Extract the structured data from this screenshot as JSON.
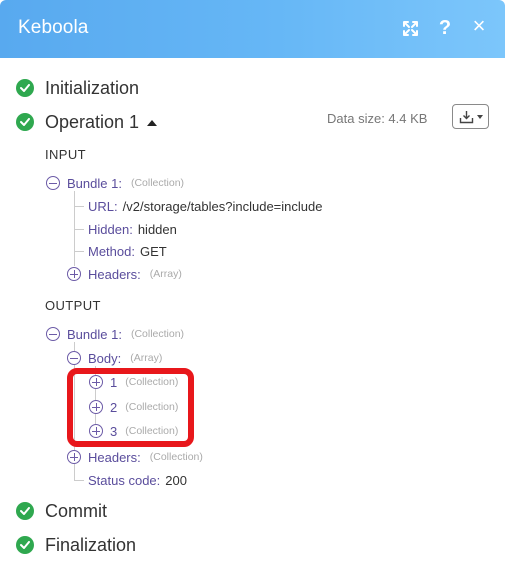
{
  "header": {
    "title": "Keboola",
    "expand_icon": "expand-icon",
    "help_label": "?",
    "close_label": "×"
  },
  "steps": {
    "initialization": "Initialization",
    "operation": "Operation 1",
    "commit": "Commit",
    "finalization": "Finalization"
  },
  "data_size": "Data size: 4.4 KB",
  "input": {
    "title": "INPUT",
    "bundle": {
      "key": "Bundle 1",
      "type": "(Collection)"
    },
    "url": {
      "key": "URL",
      "value": "/v2/storage/tables?include=include"
    },
    "hidden": {
      "key": "Hidden",
      "value": "hidden"
    },
    "method": {
      "key": "Method",
      "value": "GET"
    },
    "headers": {
      "key": "Headers",
      "type": "(Array)"
    }
  },
  "output": {
    "title": "OUTPUT",
    "bundle": {
      "key": "Bundle 1",
      "type": "(Collection)"
    },
    "body": {
      "key": "Body",
      "type": "(Array)"
    },
    "items": [
      {
        "key": "1",
        "type": "(Collection)"
      },
      {
        "key": "2",
        "type": "(Collection)"
      },
      {
        "key": "3",
        "type": "(Collection)"
      }
    ],
    "headers": {
      "key": "Headers",
      "type": "(Collection)"
    },
    "status": {
      "key": "Status code",
      "value": "200"
    }
  },
  "colors": {
    "header": "#66b7f6",
    "success": "#2fa84f",
    "key": "#5a4d9c",
    "highlight": "#e8171b"
  }
}
